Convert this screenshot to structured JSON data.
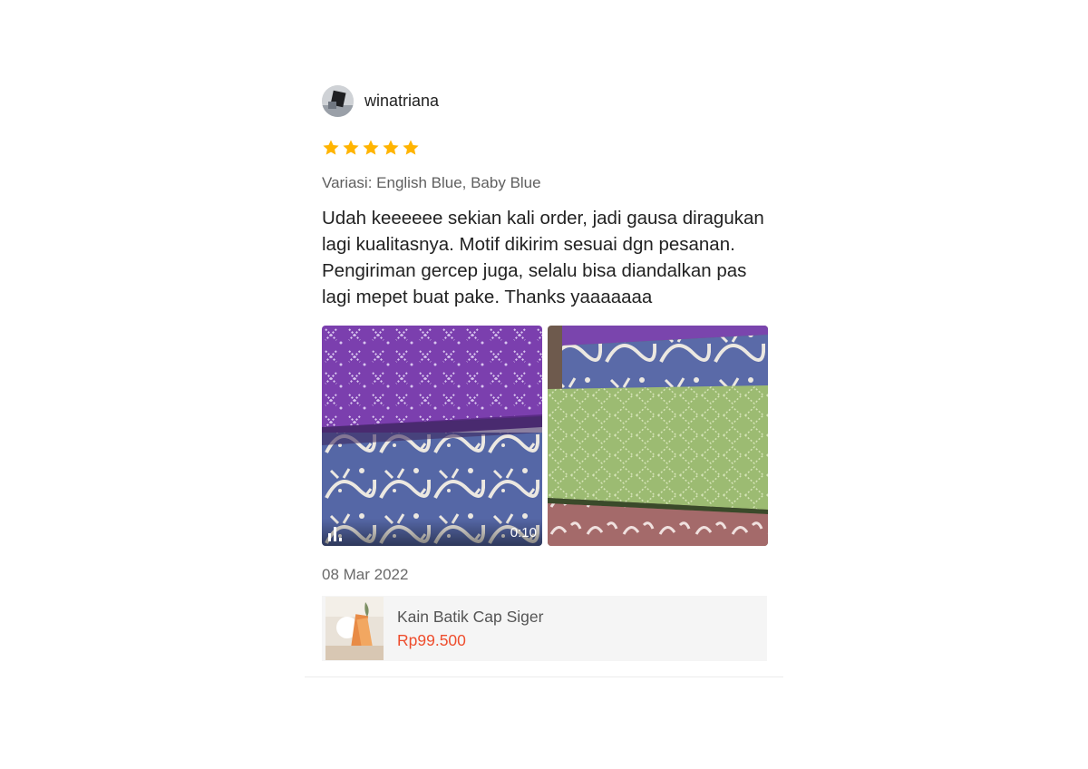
{
  "review": {
    "username": "winatriana",
    "rating": 5,
    "star_color": "#ffb400",
    "variation": "Variasi: English Blue, Baby Blue",
    "text": "Udah keeeeee sekian kali order, jadi gausa diragukan lagi kualitasnya. Motif dikirim sesuai dgn pesanan. Pengiriman gercep juga, selalu bisa diandalkan pas lagi mepet buat pake. Thanks yaaaaaaa",
    "media": [
      {
        "type": "video",
        "duration": "0:10",
        "icon": "video-icon"
      },
      {
        "type": "image"
      }
    ],
    "date": "08 Mar 2022"
  },
  "product": {
    "name": "Kain Batik Cap Siger",
    "price": "Rp99.500",
    "price_color": "#ee4d2d"
  }
}
